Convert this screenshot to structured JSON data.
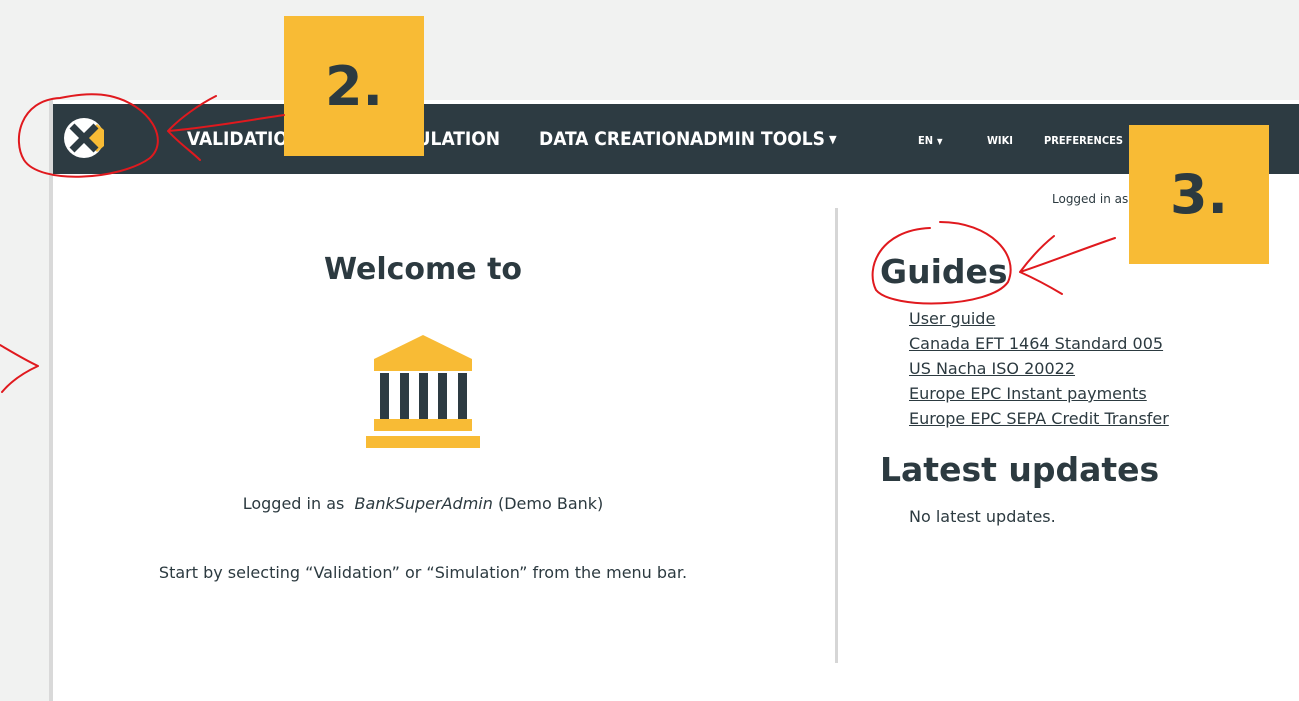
{
  "nav": {
    "items": [
      "VALIDATION",
      "SIMULATION",
      "DATA CREATION",
      "ADMIN TOOLS"
    ],
    "lang": "EN",
    "wiki": "WIKI",
    "preferences": "PREFERENCES"
  },
  "header": {
    "logged_in_short": "Logged in as"
  },
  "welcome": {
    "title": "Welcome to",
    "logged_prefix": "Logged in as ",
    "username": "BankSuperAdmin",
    "bank": "(Demo Bank)",
    "instructions": "Start by selecting “Validation” or “Simulation” from the menu bar."
  },
  "guides": {
    "title": "Guides",
    "links": [
      "User guide",
      "Canada EFT 1464 Standard 005",
      "US Nacha ISO 20022",
      "Europe EPC Instant payments",
      "Europe EPC SEPA Credit Transfer"
    ]
  },
  "updates": {
    "title": "Latest updates",
    "empty": "No latest updates."
  },
  "callouts": {
    "step2": "2.",
    "step3": "3."
  },
  "colors": {
    "navbar": "#2d3b42",
    "accent": "#f8bb35",
    "annotation": "#e0191e"
  },
  "icons": {
    "logo": "x-logo-icon",
    "bank": "bank-building-icon",
    "caret": "caret-down-icon"
  }
}
